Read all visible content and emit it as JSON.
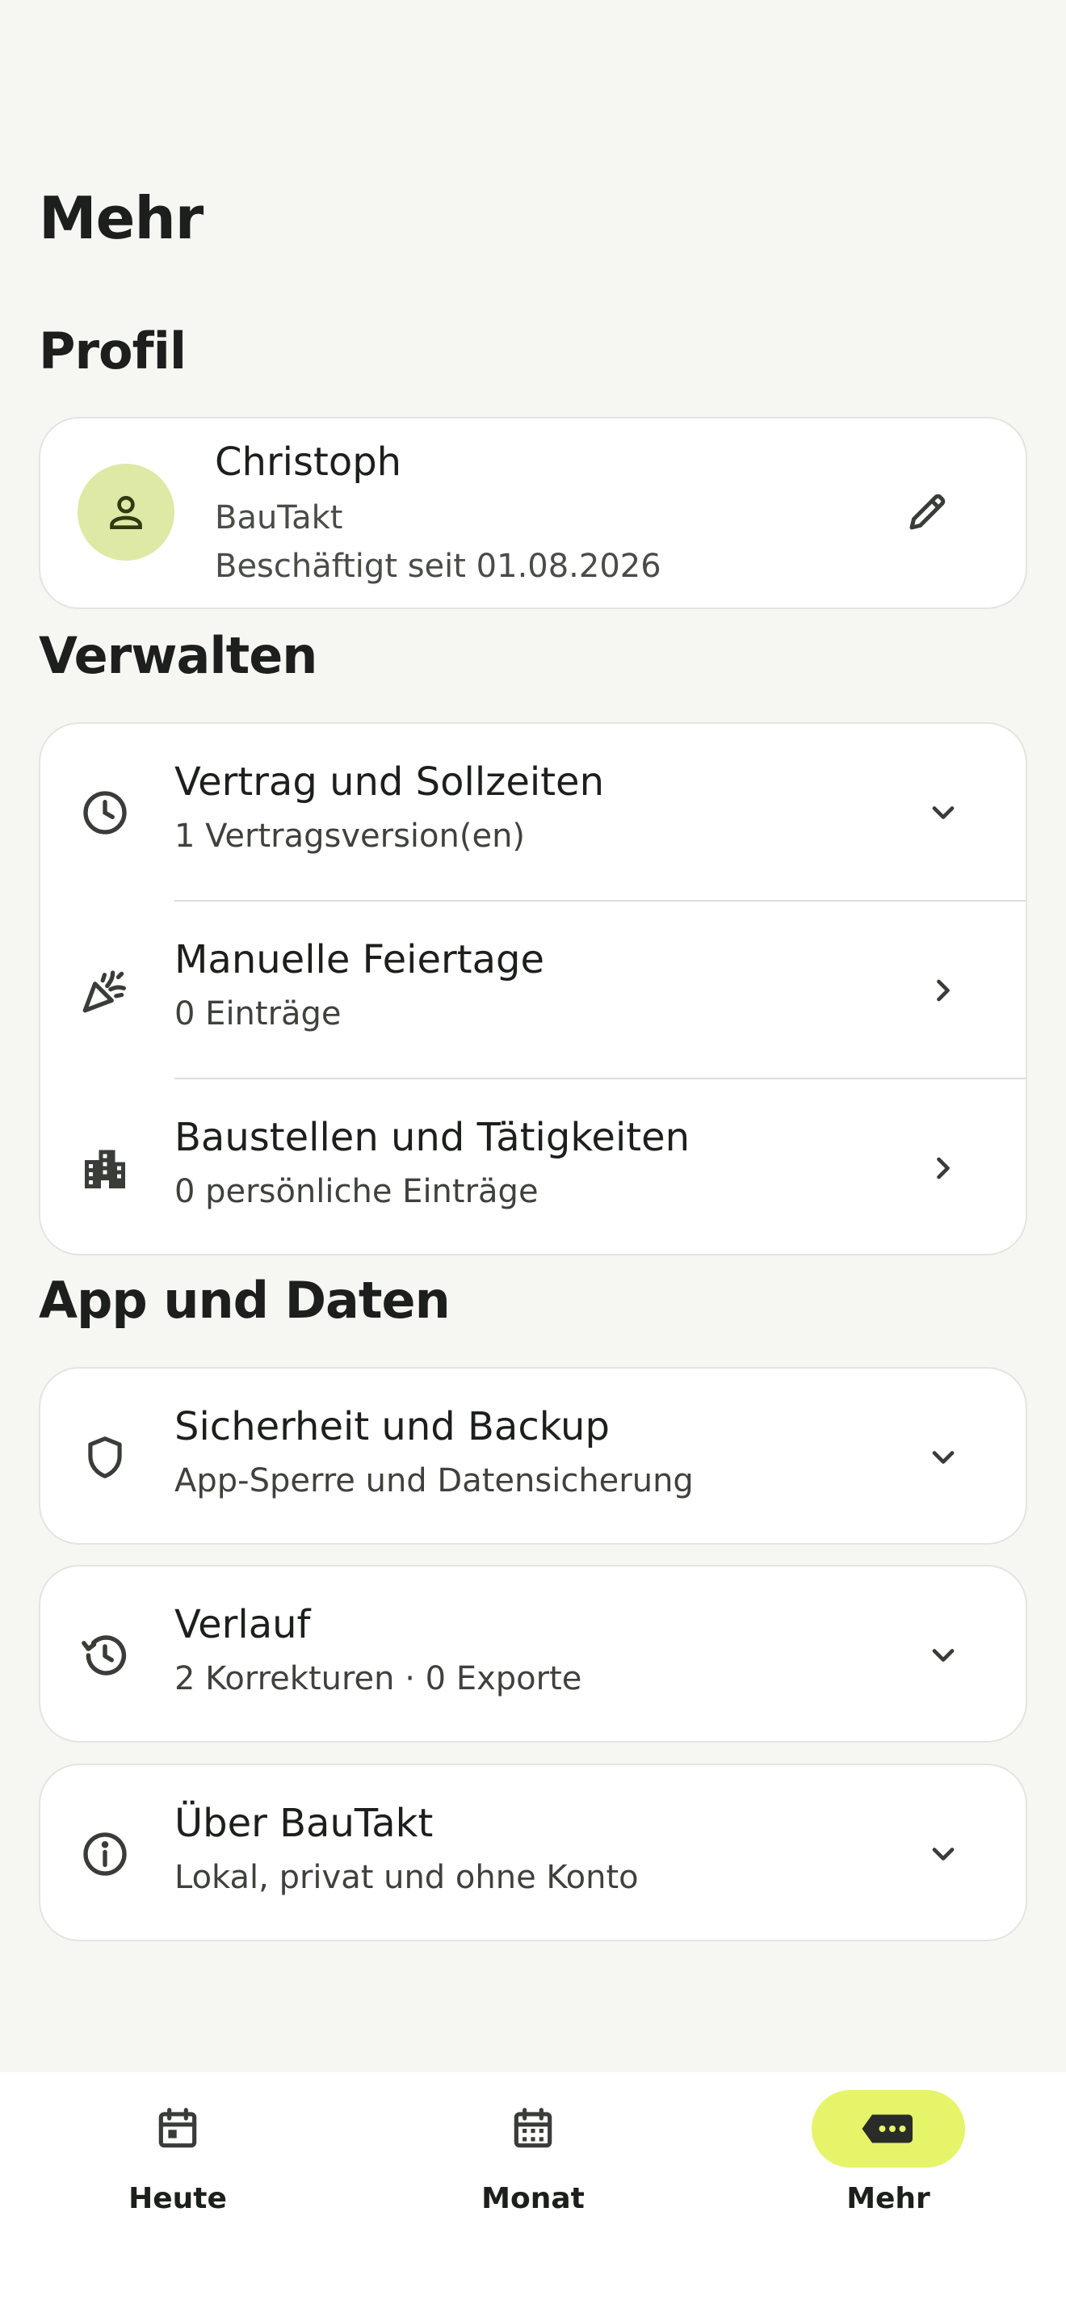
{
  "page": {
    "title": "Mehr"
  },
  "profile": {
    "section_title": "Profil",
    "name": "Christoph",
    "company": "BauTakt",
    "employed_since": "Beschäftigt seit 01.08.2026",
    "avatar_icon": "person-icon",
    "edit_icon": "pencil-icon"
  },
  "manage": {
    "section_title": "Verwalten",
    "items": [
      {
        "title": "Vertrag und Sollzeiten",
        "subtitle": "1 Vertragsversion(en)",
        "icon": "clock-icon",
        "trail": "chevron-down-icon"
      },
      {
        "title": "Manuelle Feiertage",
        "subtitle": "0 Einträge",
        "icon": "party-popper-icon",
        "trail": "chevron-right-icon"
      },
      {
        "title": "Baustellen und Tätigkeiten",
        "subtitle": "0 persönliche Einträge",
        "icon": "building-icon",
        "trail": "chevron-right-icon"
      }
    ]
  },
  "app": {
    "section_title": "App und Daten",
    "items": [
      {
        "title": "Sicherheit und Backup",
        "subtitle": "App-Sperre und Datensicherung",
        "icon": "shield-icon",
        "trail": "chevron-down-icon"
      },
      {
        "title": "Verlauf",
        "subtitle": "2 Korrekturen · 0 Exporte",
        "icon": "history-icon",
        "trail": "chevron-down-icon"
      },
      {
        "title": "Über BauTakt",
        "subtitle": "Lokal, privat und ohne Konto",
        "icon": "info-icon",
        "trail": "chevron-down-icon"
      }
    ]
  },
  "nav": {
    "items": [
      {
        "label": "Heute",
        "icon": "calendar-today-icon",
        "active": false
      },
      {
        "label": "Monat",
        "icon": "calendar-month-icon",
        "active": false
      },
      {
        "label": "Mehr",
        "icon": "more-icon",
        "active": true
      }
    ]
  },
  "colors": {
    "background": "#f6f6f3",
    "card": "#ffffff",
    "accent": "#e6f46a",
    "avatar_bg": "#dfe9a6",
    "text": "#1d1f1c"
  }
}
